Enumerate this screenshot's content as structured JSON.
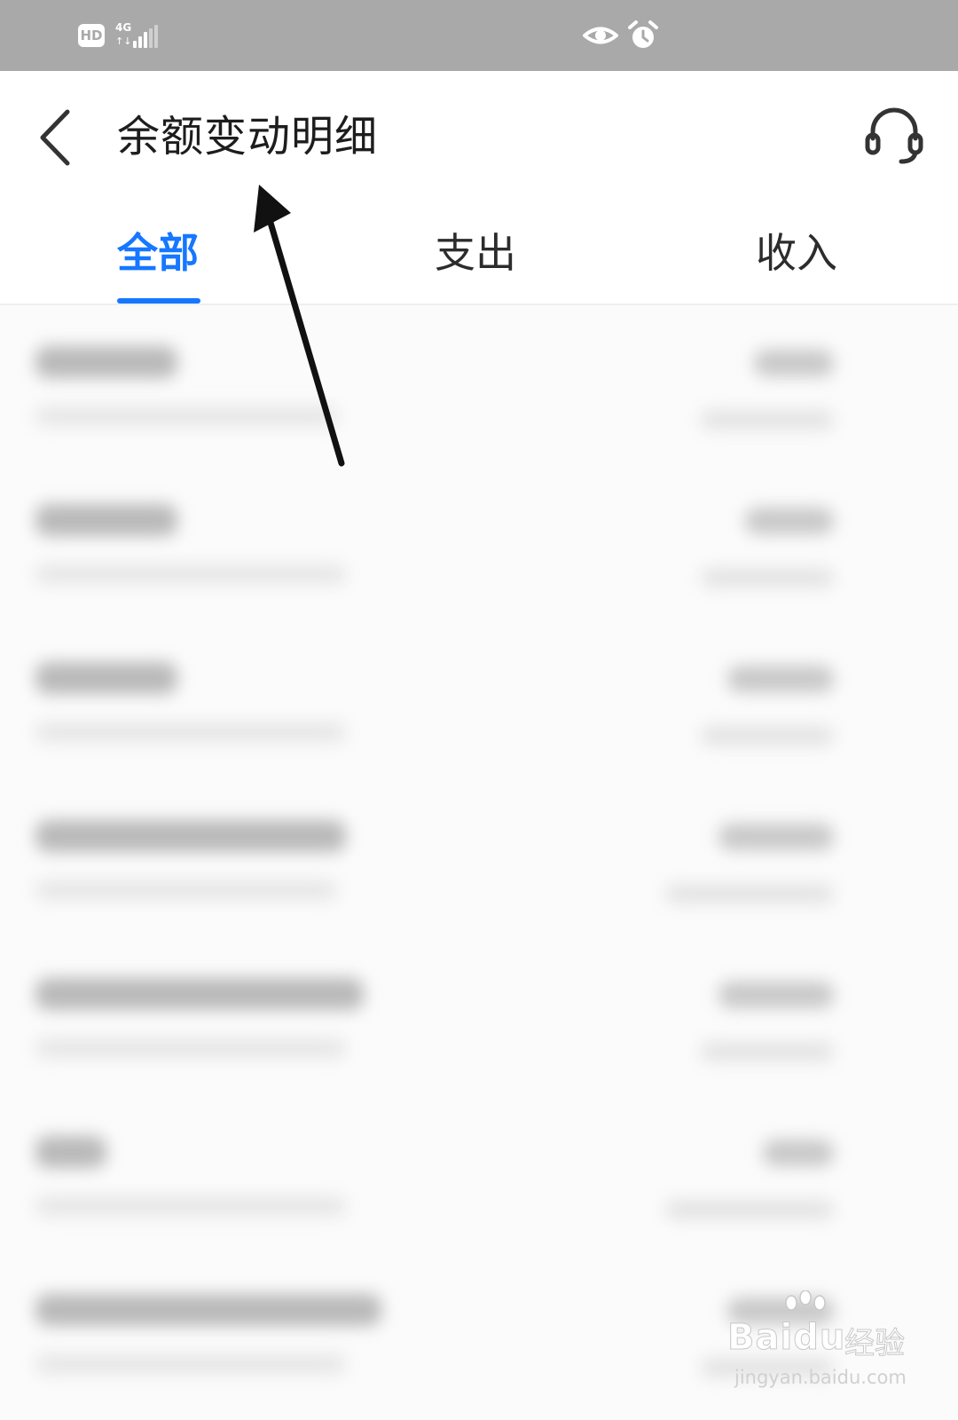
{
  "status_bar": {
    "hd_label": "HD",
    "network_label": "4G",
    "network_arrows": "↑↓",
    "icons": [
      "hd-icon",
      "signal-icon",
      "eye-icon",
      "alarm-icon"
    ]
  },
  "header": {
    "title": "余额变动明细",
    "back_icon": "chevron-left-icon",
    "service_icon": "headset-icon"
  },
  "tabs": {
    "active_color": "#1677ff",
    "items": [
      {
        "label": "全部",
        "active": true
      },
      {
        "label": "支出",
        "active": false
      },
      {
        "label": "收入",
        "active": false
      }
    ]
  },
  "list": {
    "note_blurred": true,
    "row_count": 7
  },
  "watermark": {
    "brand": "Baidu",
    "brand_cn": "经验",
    "url": "jingyan.baidu.com"
  },
  "colors": {
    "status_bar": "#a9a9a9",
    "accent": "#1677ff",
    "text": "#1d1d1d"
  }
}
